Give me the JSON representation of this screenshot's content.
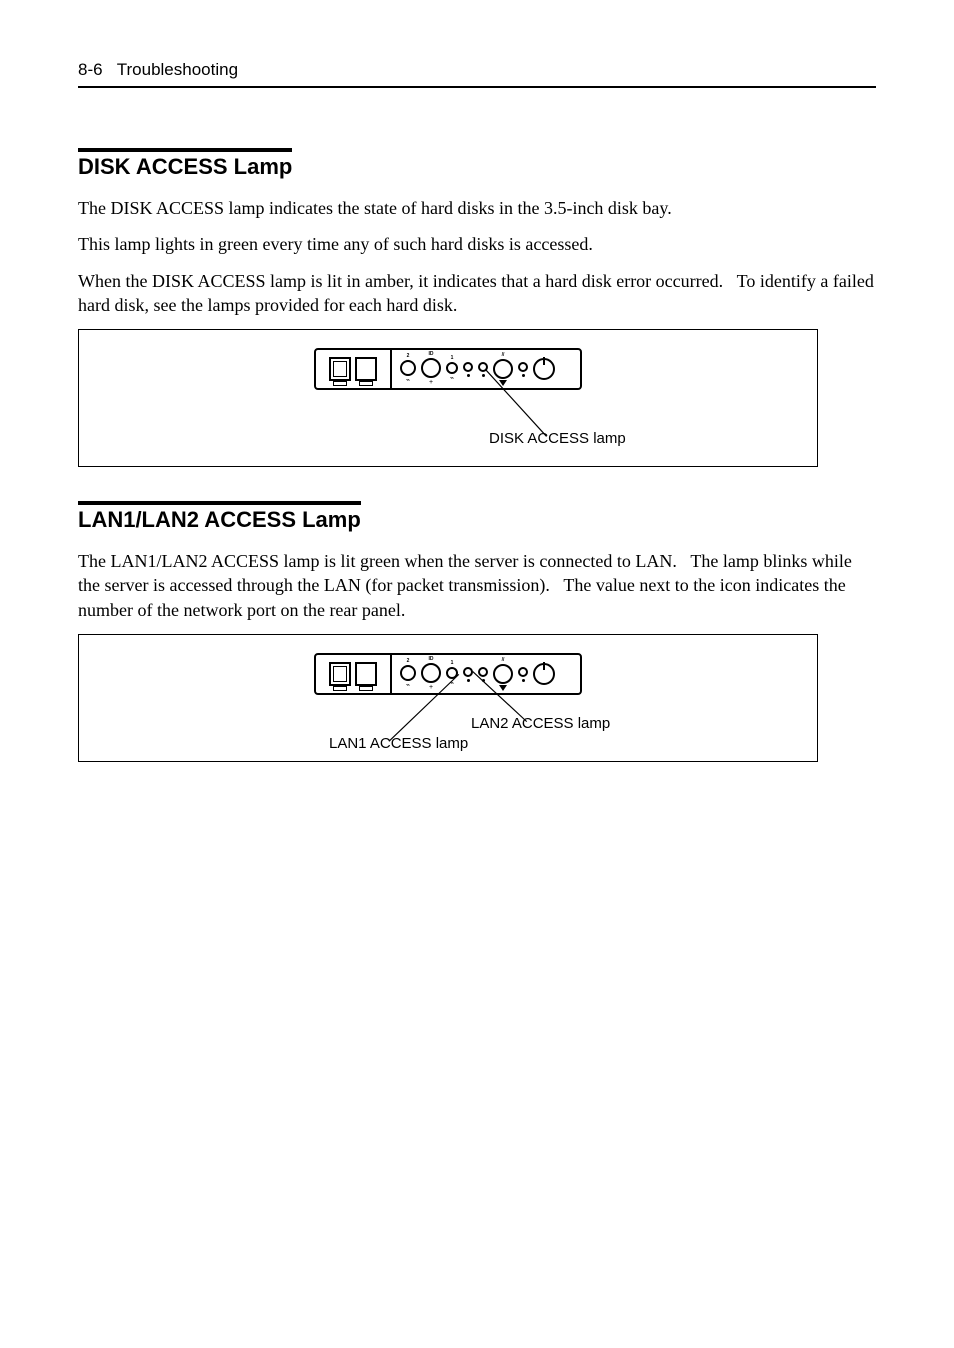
{
  "header": {
    "page_ref": "8-6   Troubleshooting"
  },
  "section1": {
    "title": "DISK ACCESS Lamp",
    "p1": "The DISK ACCESS lamp indicates the state of hard disks in the 3.5-inch disk bay.",
    "p2": "This lamp lights in green every time any of such hard disks is accessed.",
    "p3": "When the DISK ACCESS lamp is lit in amber, it indicates that a hard disk error occurred.   To identify a failed hard disk, see the lamps provided for each hard disk.",
    "callout": "DISK ACCESS lamp"
  },
  "section2": {
    "title": "LAN1/LAN2 ACCESS Lamp",
    "p1": "The LAN1/LAN2 ACCESS lamp is lit green when the server is connected to LAN.   The lamp blinks while the server is accessed through the LAN (for packet transmission).   The value next to the icon indicates the number of the network port on the rear panel.",
    "callout1": "LAN1 ACCESS lamp",
    "callout2": "LAN2 ACCESS lamp"
  },
  "device": {
    "labels": {
      "col1_top": "2",
      "col2_top": "ID",
      "col3_top": "1",
      "slash_top": "//"
    }
  }
}
